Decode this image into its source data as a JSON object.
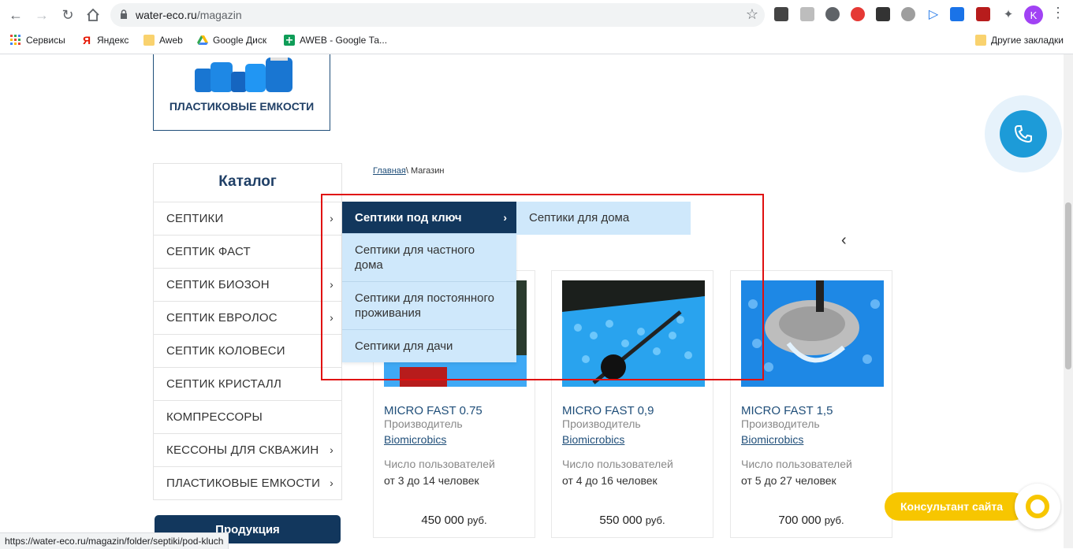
{
  "browser": {
    "url_host": "water-eco.ru",
    "url_path": "/magazin",
    "profile_initial": "K",
    "status_url": "https://water-eco.ru/magazin/folder/septiki/pod-kluch"
  },
  "bookmarks": {
    "items": [
      {
        "label": "Сервисы",
        "icon": "apps-grid-icon"
      },
      {
        "label": "Яндекс",
        "icon": "yandex-icon"
      },
      {
        "label": "Aweb",
        "icon": "folder-icon"
      },
      {
        "label": "Google Диск",
        "icon": "google-drive-icon"
      },
      {
        "label": "AWEB  - Google Та...",
        "icon": "google-sheets-icon"
      }
    ],
    "other": "Другие закладки"
  },
  "top_card": {
    "title": "ПЛАСТИКОВЫЕ ЕМКОСТИ"
  },
  "catalog": {
    "title": "Каталог",
    "items": [
      {
        "label": "СЕПТИКИ",
        "has_sub": true
      },
      {
        "label": "СЕПТИК ФАСТ",
        "has_sub": false
      },
      {
        "label": "СЕПТИК БИОЗОН",
        "has_sub": true
      },
      {
        "label": "СЕПТИК ЕВРОЛОС",
        "has_sub": true
      },
      {
        "label": "СЕПТИК КОЛОВЕСИ",
        "has_sub": false
      },
      {
        "label": "СЕПТИК КРИСТАЛЛ",
        "has_sub": false
      },
      {
        "label": "КОМПРЕССОРЫ",
        "has_sub": false
      },
      {
        "label": "КЕССОНЫ ДЛЯ СКВАЖИН",
        "has_sub": true
      },
      {
        "label": "ПЛАСТИКОВЫЕ ЕМКОСТИ",
        "has_sub": true
      }
    ],
    "products_button": "Продукция"
  },
  "breadcrumb": {
    "home": "Главная",
    "separator": "\\ ",
    "current": "Магазин"
  },
  "dropdown": {
    "level1": [
      {
        "label": "Септики под ключ",
        "active": true
      },
      {
        "label": "Септики для частного дома",
        "active": false
      },
      {
        "label": "Септики для постоянного проживания",
        "active": false
      },
      {
        "label": "Септики для дачи",
        "active": false
      }
    ],
    "level2": [
      {
        "label": "Септики для дома"
      }
    ]
  },
  "products": [
    {
      "name": "MICRO FAST 0.75",
      "maker_label": "Производитель",
      "brand": "Biomicrobics",
      "users_label": "Число пользователей",
      "users_range": "от 3 до 14 человек",
      "price": "450 000",
      "currency": "руб."
    },
    {
      "name": "MICRO FAST 0,9",
      "maker_label": "Производитель",
      "brand": "Biomicrobics",
      "users_label": "Число пользователей",
      "users_range": "от 4 до 16 человек",
      "price": "550 000",
      "currency": "руб."
    },
    {
      "name": "MICRO FAST 1,5",
      "maker_label": "Производитель",
      "brand": "Biomicrobics",
      "users_label": "Число пользователей",
      "users_range": "от 5 до 27 человек",
      "price": "700 000",
      "currency": "руб."
    }
  ],
  "widgets": {
    "consultant": "Консультант сайта"
  },
  "colors": {
    "brand_dark": "#12375d",
    "menu_light": "#cfe8fb",
    "highlight": "#e01010",
    "consultant": "#f7c600",
    "callback": "#1d9bd8"
  }
}
